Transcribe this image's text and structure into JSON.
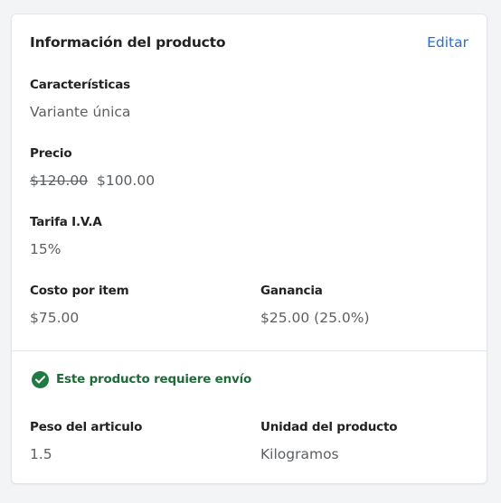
{
  "card": {
    "title": "Información del producto",
    "edit_label": "Editar"
  },
  "features": {
    "label": "Características",
    "value": "Variante única"
  },
  "price": {
    "label": "Precio",
    "compare_at": "$120.00",
    "current": "$100.00"
  },
  "tax": {
    "label": "Tarifa I.V.A",
    "value": "15%"
  },
  "cost": {
    "label": "Costo por item",
    "value": "$75.00"
  },
  "profit": {
    "label": "Ganancia",
    "value": "$25.00 (25.0%)"
  },
  "shipping": {
    "status_text": "Este producto requiere envío",
    "icon": "check-circle-icon"
  },
  "weight": {
    "label": "Peso del articulo",
    "value": "1.5"
  },
  "unit": {
    "label": "Unidad del producto",
    "value": "Kilogramos"
  },
  "colors": {
    "accent": "#2c6ecb",
    "success": "#1f7a43",
    "text": "#202223",
    "muted": "#5c5f62"
  }
}
